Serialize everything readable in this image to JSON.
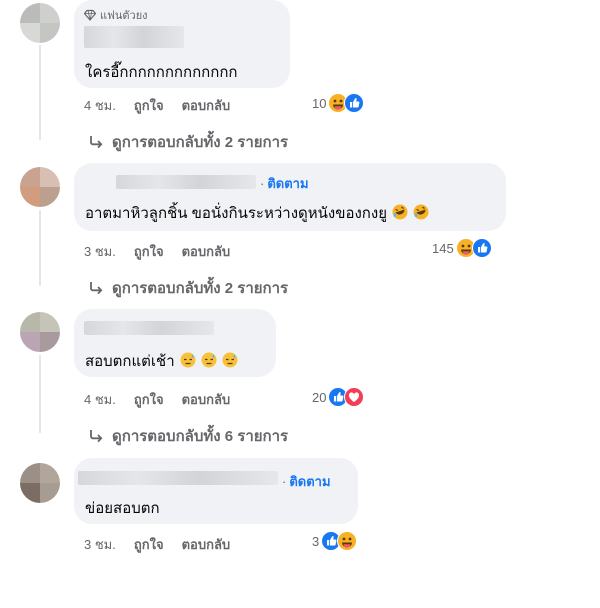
{
  "comments": [
    {
      "badge": "แฟนตัวยง",
      "text": "ใครอี๊กกกกกกกกกกกกก",
      "time": "4 ชม.",
      "like_label": "ถูกใจ",
      "reply_label": "ตอบกลับ",
      "reaction_count": "10",
      "reactions": [
        "haha-icon",
        "like-icon"
      ],
      "replies_label": "ดูการตอบกลับทั้ง 2 รายการ"
    },
    {
      "follow_label": "ติดตาม",
      "text": "อาตมาหิวลูกชิ้น ขอนั่งกินระหว่างดูหนังของกงยู",
      "time": "3 ชม.",
      "like_label": "ถูกใจ",
      "reply_label": "ตอบกลับ",
      "reaction_count": "145",
      "reactions": [
        "haha-icon",
        "like-icon"
      ],
      "replies_label": "ดูการตอบกลับทั้ง 2 รายการ"
    },
    {
      "text": "สอบตกแต่เช้า",
      "time": "4 ชม.",
      "like_label": "ถูกใจ",
      "reply_label": "ตอบกลับ",
      "reaction_count": "20",
      "reactions": [
        "like-icon",
        "love-icon"
      ],
      "replies_label": "ดูการตอบกลับทั้ง 6 รายการ"
    },
    {
      "follow_label": "ติดตาม",
      "text": "ข่อยสอบตก",
      "time": "3 ชม.",
      "like_label": "ถูกใจ",
      "reply_label": "ตอบกลับ",
      "reaction_count": "3",
      "reactions": [
        "like-icon",
        "haha-icon"
      ]
    }
  ],
  "colors": {
    "bubble": "#f0f2f5",
    "meta_text": "#65676b",
    "link": "#1877f2",
    "like": "#1877f2",
    "haha": "#f7b125",
    "love": "#f33e58"
  }
}
